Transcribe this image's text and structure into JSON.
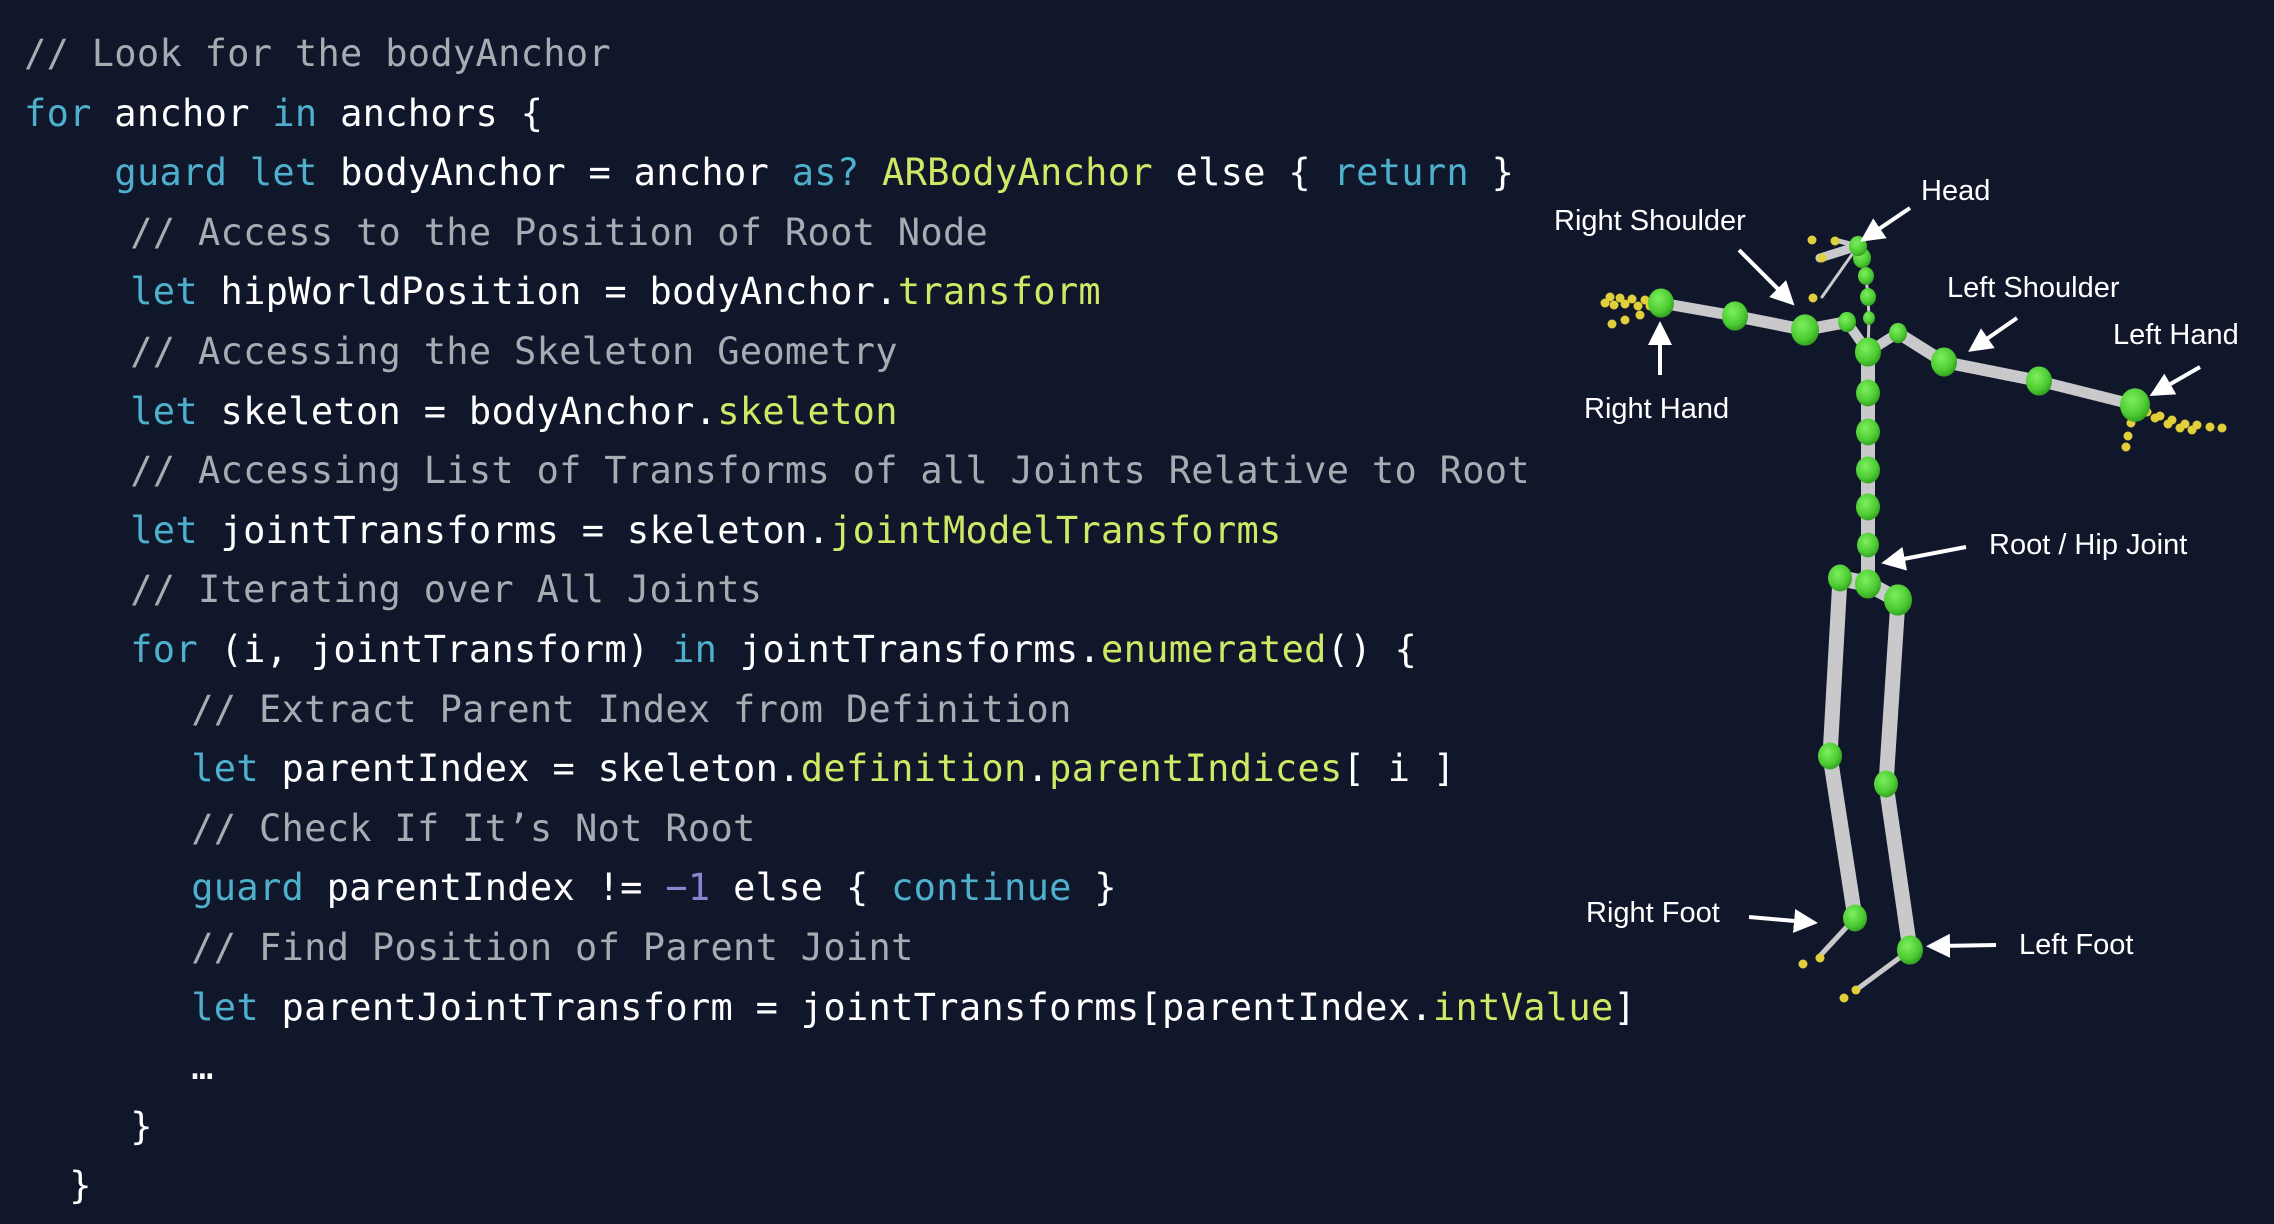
{
  "code": {
    "lines": [
      {
        "indent": 0,
        "tokens": [
          [
            "comment",
            "// Look for the bodyAnchor"
          ]
        ]
      },
      {
        "indent": 0,
        "tokens": [
          [
            "kw",
            "for"
          ],
          [
            "plain",
            " anchor "
          ],
          [
            "kw",
            "in"
          ],
          [
            "plain",
            " anchors {"
          ]
        ]
      },
      {
        "indent": 4,
        "tokens": [
          [
            "kw",
            "guard"
          ],
          [
            "plain",
            " "
          ],
          [
            "kw",
            "let"
          ],
          [
            "plain",
            " bodyAnchor = anchor "
          ],
          [
            "kw",
            "as?"
          ],
          [
            "plain",
            " "
          ],
          [
            "type",
            "ARBodyAnchor"
          ],
          [
            "plain",
            " else { "
          ],
          [
            "kw",
            "return"
          ],
          [
            "plain",
            " }"
          ]
        ]
      },
      {
        "indent": 4.7,
        "tokens": [
          [
            "comment",
            "// Access to the Position of Root Node"
          ]
        ]
      },
      {
        "indent": 4.7,
        "tokens": [
          [
            "kw",
            "let"
          ],
          [
            "plain",
            " hipWorldPosition = bodyAnchor."
          ],
          [
            "type",
            "transform"
          ]
        ]
      },
      {
        "indent": 4.7,
        "tokens": [
          [
            "comment",
            "// Accessing the Skeleton Geometry"
          ]
        ]
      },
      {
        "indent": 4.7,
        "tokens": [
          [
            "kw",
            "let"
          ],
          [
            "plain",
            " skeleton = bodyAnchor."
          ],
          [
            "type",
            "skeleton"
          ]
        ]
      },
      {
        "indent": 4.7,
        "tokens": [
          [
            "comment",
            "// Accessing List of Transforms of all Joints Relative to Root"
          ]
        ]
      },
      {
        "indent": 4.7,
        "tokens": [
          [
            "kw",
            "let"
          ],
          [
            "plain",
            " jointTransforms = skeleton."
          ],
          [
            "type",
            "jointModelTransforms"
          ]
        ]
      },
      {
        "indent": 4.7,
        "tokens": [
          [
            "comment",
            "// Iterating over All Joints"
          ]
        ]
      },
      {
        "indent": 4.7,
        "tokens": [
          [
            "kw",
            "for"
          ],
          [
            "plain",
            " (i, jointTransform) "
          ],
          [
            "kw",
            "in"
          ],
          [
            "plain",
            " jointTransforms."
          ],
          [
            "type",
            "enumerated"
          ],
          [
            "plain",
            "() {"
          ]
        ]
      },
      {
        "indent": 7.4,
        "tokens": [
          [
            "comment",
            "// Extract Parent Index from Definition"
          ]
        ]
      },
      {
        "indent": 7.4,
        "tokens": [
          [
            "kw",
            "let"
          ],
          [
            "plain",
            " parentIndex = skeleton."
          ],
          [
            "type",
            "definition"
          ],
          [
            "plain",
            "."
          ],
          [
            "type",
            "parentIndices"
          ],
          [
            "plain",
            "[ i ]"
          ]
        ]
      },
      {
        "indent": 7.4,
        "tokens": [
          [
            "comment",
            "// Check If It’s Not Root"
          ]
        ]
      },
      {
        "indent": 7.4,
        "tokens": [
          [
            "kw",
            "guard"
          ],
          [
            "plain",
            " parentIndex != "
          ],
          [
            "num",
            "−1"
          ],
          [
            "plain",
            " else { "
          ],
          [
            "kw",
            "continue"
          ],
          [
            "plain",
            " }"
          ]
        ]
      },
      {
        "indent": 7.4,
        "tokens": [
          [
            "comment",
            "// Find Position of Parent Joint"
          ]
        ]
      },
      {
        "indent": 7.4,
        "tokens": [
          [
            "kw",
            "let"
          ],
          [
            "plain",
            " parentJointTransform = jointTransforms[parentIndex."
          ],
          [
            "type",
            "intValue"
          ],
          [
            "plain",
            "]"
          ]
        ]
      },
      {
        "indent": 7.4,
        "tokens": [
          [
            "plain",
            "…"
          ]
        ]
      },
      {
        "indent": 4.7,
        "tokens": [
          [
            "plain",
            "}"
          ]
        ]
      },
      {
        "indent": 2,
        "tokens": [
          [
            "plain",
            "}"
          ]
        ]
      }
    ]
  },
  "diagram": {
    "labels": {
      "head": "Head",
      "right_shoulder": "Right Shoulder",
      "left_shoulder": "Left Shoulder",
      "left_hand": "Left Hand",
      "right_hand": "Right Hand",
      "root": "Root / Hip Joint",
      "right_foot": "Right Foot",
      "left_foot": "Left Foot"
    },
    "colors": {
      "background": "#11172b",
      "joint": "#5ad83c",
      "bone": "#c9c9cc",
      "finger_joint": "#e0cf3a",
      "label": "#ffffff"
    }
  }
}
